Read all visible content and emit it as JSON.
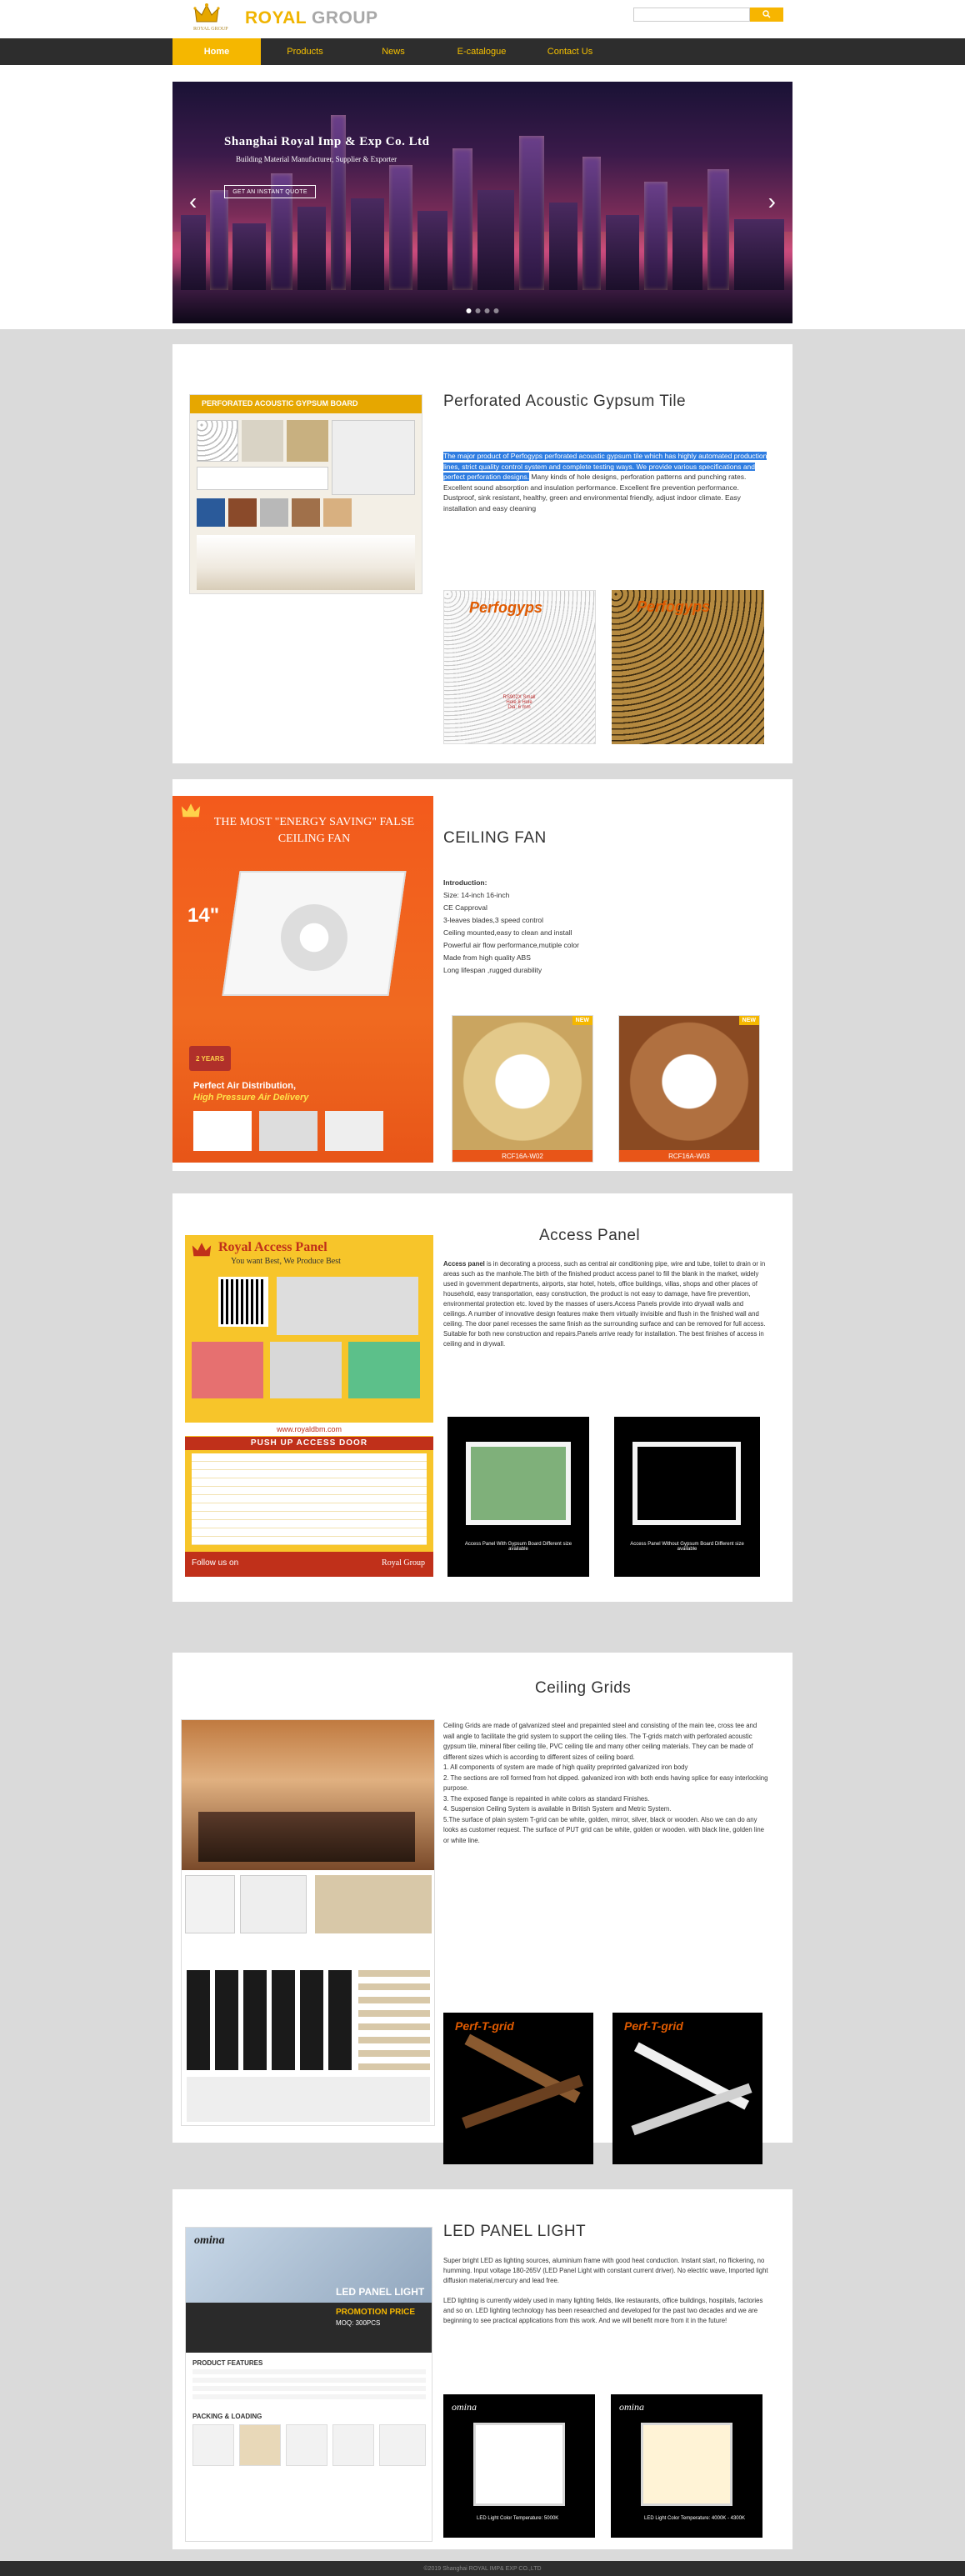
{
  "header": {
    "logo_crown_text": "ROYAL GROUP",
    "logo_royal": "ROYAL",
    "logo_group": "GROUP",
    "search_placeholder": ""
  },
  "nav": {
    "items": [
      {
        "label": "Home",
        "active": true
      },
      {
        "label": "Products",
        "active": false
      },
      {
        "label": "News",
        "active": false
      },
      {
        "label": "E-catalogue",
        "active": false
      },
      {
        "label": "Contact Us",
        "active": false
      }
    ]
  },
  "banner": {
    "title": "Shanghai Royal Imp & Exp Co. Ltd",
    "subtitle": "Building Material Manufacturer, Supplier & Exporter",
    "cta": "GET AN INSTANT QUOTE",
    "prev": "‹",
    "next": "›"
  },
  "sections": {
    "gypsum": {
      "title": "Perforated Acoustic Gypsum Tile",
      "highlight": "The major product of Perfogyps perforated acoustic gypsum tile which has highly automated production lines, strict quality control system and complete testing ways. We provide various specifications and perfect perforation designs.",
      "text": "Many kinds of hole designs, perforation patterns and punching rates. Excellent sound absorption and insulation performance. Excellent fire prevention performance. Dustproof, sink resistant, healthy, green and environmental friendly, adjust indoor climate. Easy installation and easy cleaning",
      "poster_heading": "PERFORATED ACOUSTIC GYPSUM BOARD",
      "thumb1_logo": "Perfogyps",
      "thumb1_caption": "RS902X Small Hole 8 Hole Dia: 6 mm",
      "thumb2_logo": "Perfogyps"
    },
    "fan": {
      "title": "CEILING FAN",
      "lines": [
        "Introduction:",
        "Size: 14-inch 16-inch",
        "CE Capproval",
        "3-leaves blades,3 speed control",
        "Ceiling mounted,easy to clean and install",
        "Powerful air flow performance,mutiple color",
        "Made from high quality ABS",
        "Long lifespan ,rugged durability"
      ],
      "poster_headline": "THE MOST \"ENERGY SAVING\" FALSE CEILING FAN",
      "poster_size": "14\"",
      "poster_perfect": "Perfect Air Distribution,",
      "poster_pressure": "High Pressure Air Delivery",
      "poster_warranty": "2 YEARS",
      "thumb1_caption": "RCF16A-W02",
      "thumb2_caption": "RCF16A-W03",
      "thumb_badge": "NEW"
    },
    "access": {
      "title": "Access Panel",
      "lead": "Access panel",
      "text": " is in decorating a process, such as central air conditioning pipe, wire and tube, toilet to drain or in areas such as the manhole.The birth of the finished product access panel to fill the blank in the market, widely used in government departments, airports, star hotel, hotels, office buildings, villas, shops and other places of household, easy transportation, easy construction, the product is not easy to damage, have fire prevention, environmental protection etc. loved by the masses of users.Access Panels provide into drywall walls and ceilings. A number of innovative design features make them virtually invisible and flush in the finished wall and ceiling. The door panel recesses the same finish as the surrounding surface and can be removed for full access. Suitable for both new construction and repairs.Panels arrive ready for installation. The best finishes of access in ceiling and in drywall.",
      "poster_title": "Royal Access Panel",
      "poster_slogan": "You want Best, We Produce Best",
      "poster_push": "PUSH UP ACCESS DOOR",
      "poster_url": "www.royaldbm.com",
      "poster_follow": "Follow us on",
      "poster_brand": "Royal Group",
      "thumb1_caption": "Access Panel With Gypsum Board Different size available",
      "thumb2_caption": "Access Panel Without Gypsum Board Different size available"
    },
    "grids": {
      "title": "Ceiling Grids",
      "lines": [
        "Ceiling Grids are made of galvanized steel and prepainted steel and consisting of the main tee, cross tee and wall angle to facilitate the grid system to support the ceiling tiles. The T-grids match with perforated acoustic gypsum tile, mineral fiber ceiling tile, PVC ceiling tile and many other ceiling materials. They can be made of different sizes which is according to different sizes of ceiling board.",
        "1. All components of system are made of high quality preprinted galvanized iron body",
        "2. The sections are roll formed from hot dipped. galvanized iron with both ends having splice for easy  interlocking purpose.",
        "3. The exposed flange is repainted in white colors as standard Finishes.",
        "4.  Suspension Ceiling System is available in British System and Metric System.",
        "5.The surface of plain system T-grid can be white, golden, mirror, silver, black or wooden. Also we can do any looks as customer request. The surface of PUT grid can be white, golden or wooden. with black line, golden line or white line."
      ],
      "thumb_logo": "Perf-T-grid"
    },
    "led": {
      "title": "LED PANEL LIGHT",
      "para1": "Super bright LED as lighting sources, aluminium frame with good heat conduction. Instant start, no flickering, no humming. Input voltage 180-265V (LED Panel Light with constant current driver). No electric wave, Imported light diffusion material,mercury and lead free.",
      "para2": "LED lighting is currently widely used in many lighting fields, like restaurants, office buildings, hospitals, factories and so on. LED lighting technology has been researched and developed for the past two decades and we are beginning to see practical applications from this work. And we will benefit more from it in the future!",
      "poster_brand": "omina",
      "poster_title": "LED PANEL LIGHT",
      "poster_promo": "PROMOTION PRICE",
      "poster_moq": "MOQ: 300PCS",
      "poster_features": "PRODUCT FEATURES",
      "poster_packing": "PACKING & LOADING",
      "thumb1_brand": "omina",
      "thumb1_caption": "LED Light Color Temperature: 5000K",
      "thumb2_brand": "omina",
      "thumb2_caption": "LED Light Color Temperature: 4000K - 4300K"
    }
  },
  "footer": {
    "text": "©2019 Shanghai ROYAL IMP& EXP CO.,LTD"
  },
  "colors": {
    "accent": "#f5b700",
    "nav_bg": "#2d2d2d",
    "grey_bg": "#dadada"
  }
}
